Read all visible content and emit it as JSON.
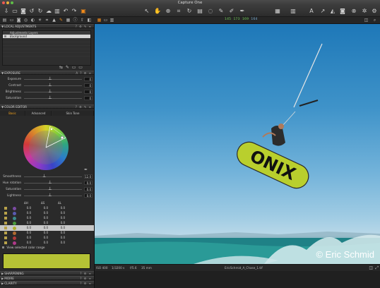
{
  "app": {
    "title": "Capture One"
  },
  "toolbar": {
    "left_icons": [
      "import-icon",
      "folder-icon",
      "camera-icon",
      "rotate-left-icon",
      "rotate-right-icon",
      "cloud-icon",
      "trash-icon",
      "undo-icon",
      "redo-icon",
      "color-icon"
    ],
    "center_icons": [
      "cursor-tool-icon",
      "pan-tool-icon",
      "zoom-tool-icon",
      "crop-tool-icon",
      "rotate-tool-icon",
      "keystone-tool-icon",
      "spot-tool-icon",
      "brush-tool-icon",
      "eraser-tool-icon",
      "picker-tool-icon"
    ],
    "right_icons": [
      "grid-icon",
      "compare-icon",
      "text-icon",
      "arrow-icon",
      "exposure-warning-icon",
      "camera-capture-icon",
      "delete-icon",
      "settings-icon",
      "gear-icon"
    ]
  },
  "readout": {
    "r": "145",
    "g": "173",
    "b": "169",
    "extra": "164"
  },
  "sections": {
    "local_adjustments": "LOCAL ADJUSTMENTS",
    "layers_header": "Adjustments Layers",
    "layer_name": "Background",
    "exposure": "EXPOSURE",
    "color_editor": "COLOR EDITOR",
    "sharpening": "SHARPENING",
    "moire": "MOIRE",
    "clarity": "CLARITY"
  },
  "exposure": [
    {
      "label": "Exposure",
      "value": "0",
      "pos": 0.45
    },
    {
      "label": "Contrast",
      "value": "0",
      "pos": 0.45
    },
    {
      "label": "Brightness",
      "value": "0",
      "pos": 0.45
    },
    {
      "label": "Saturation",
      "value": "0",
      "pos": 0.45
    }
  ],
  "color_tabs": [
    "Basic",
    "Advanced",
    "Skin Tone"
  ],
  "color_editor_sliders": [
    {
      "label": "Smoothness",
      "value": "12.0",
      "pos": 0.35
    },
    {
      "label": "Hue rotation",
      "value": "0.0",
      "pos": 0.45
    },
    {
      "label": "Saturation",
      "value": "0.0",
      "pos": 0.45
    },
    {
      "label": "Lightness",
      "value": "0.0",
      "pos": 0.45
    }
  ],
  "color_table": {
    "headers": [
      "ΔH",
      "ΔS",
      "ΔL"
    ],
    "rows": [
      {
        "color": "#7a4aa0",
        "h": "0.0",
        "s": "0.0",
        "l": "0.0",
        "selected": false
      },
      {
        "color": "#5a5ab0",
        "h": "0.0",
        "s": "0.0",
        "l": "0.0",
        "selected": false
      },
      {
        "color": "#3a8a8a",
        "h": "0.0",
        "s": "0.0",
        "l": "0.0",
        "selected": false
      },
      {
        "color": "#4a9a3a",
        "h": "0.0",
        "s": "0.0",
        "l": "0.0",
        "selected": false
      },
      {
        "color": "#b0b030",
        "h": "0.0",
        "s": "0.0",
        "l": "0.0",
        "selected": true
      },
      {
        "color": "#b06a30",
        "h": "0.0",
        "s": "0.0",
        "l": "0.0",
        "selected": false
      },
      {
        "color": "#b03a3a",
        "h": "0.0",
        "s": "0.0",
        "l": "0.0",
        "selected": false
      },
      {
        "color": "#b03a8a",
        "h": "0.0",
        "s": "0.0",
        "l": "0.0",
        "selected": false
      }
    ]
  },
  "view_range_label": "View selected color range",
  "selected_swatch": "#b5c235",
  "photo": {
    "watermark": "© Eric Schmid",
    "board_text": "ONIX"
  },
  "status": {
    "iso": "ISO 400",
    "shutter": "1/3200 s",
    "aperture": "f/5.6",
    "focal": "35 mm",
    "filename": "EricSchmid_A_Chase_1.tif"
  }
}
